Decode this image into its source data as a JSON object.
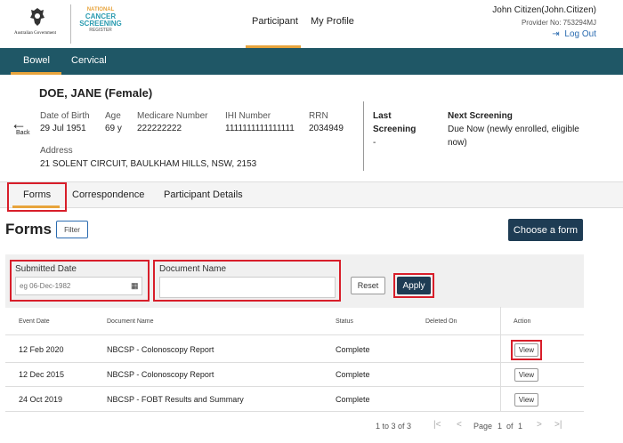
{
  "header": {
    "gov_text": "Australian Government",
    "ncsr_lines": [
      "NATIONAL",
      "CANCER",
      "SCREENING",
      "REGISTER"
    ],
    "nav": [
      "Participant",
      "My Profile"
    ],
    "user_name": "John Citizen(John.Citizen)",
    "provider": "Provider No: 753294MJ",
    "logout": "Log Out"
  },
  "tabs": [
    "Bowel",
    "Cervical"
  ],
  "participant": {
    "name": "DOE, JANE (Female)",
    "back": "Back",
    "dob_label": "Date of Birth",
    "dob": "29 Jul 1951",
    "age_label": "Age",
    "age": "69 y",
    "medicare_label": "Medicare Number",
    "medicare": "222222222",
    "ihi_label": "IHI Number",
    "ihi": "1111111111111111",
    "rrn_label": "RRN",
    "rrn": "2034949",
    "address_label": "Address",
    "address": "21 SOLENT CIRCUIT, BAULKHAM HILLS, NSW, 2153",
    "last_label_1": "Last",
    "last_label_2": "Screening",
    "last_value": "-",
    "next_label": "Next Screening",
    "next_value_1": "Due Now (newly enrolled, eligible",
    "next_value_2": "now)"
  },
  "subtabs": [
    "Forms",
    "Correspondence",
    "Participant Details"
  ],
  "forms": {
    "title": "Forms",
    "filter": "Filter",
    "choose": "Choose a form",
    "submitted_label": "Submitted Date",
    "submitted_placeholder": "eg 06-Dec-1982",
    "docname_label": "Document Name",
    "docname_value": "",
    "reset": "Reset",
    "apply": "Apply"
  },
  "table": {
    "headers": [
      "Event Date",
      "Document Name",
      "Status",
      "Deleted On",
      "Action"
    ],
    "rows": [
      {
        "date": "12 Feb 2020",
        "doc": "NBCSP - Colonoscopy Report",
        "status": "Complete",
        "deleted": "",
        "action": "View"
      },
      {
        "date": "12 Dec 2015",
        "doc": "NBCSP - Colonoscopy Report",
        "status": "Complete",
        "deleted": "",
        "action": "View"
      },
      {
        "date": "24 Oct 2019",
        "doc": "NBCSP - FOBT Results and Summary",
        "status": "Complete",
        "deleted": "",
        "action": "View"
      }
    ]
  },
  "pagination": {
    "range": "1 to 3 of 3",
    "page_label": "Page",
    "page": "1",
    "of_label": "of",
    "total": "1"
  },
  "colors": {
    "teal": "#1f5766",
    "accent": "#e8a43c",
    "button_dark": "#1e3c54",
    "highlight_red": "#d81e2a",
    "link": "#2a6bb0"
  }
}
